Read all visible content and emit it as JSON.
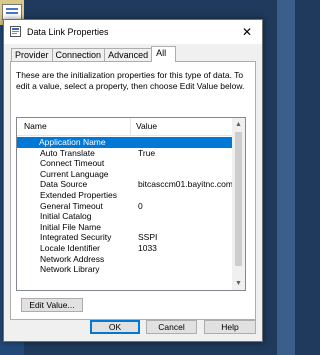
{
  "window": {
    "title": "Data Link Properties",
    "close_glyph": "✕"
  },
  "tabs": [
    {
      "label": "Provider"
    },
    {
      "label": "Connection"
    },
    {
      "label": "Advanced"
    },
    {
      "label": "All",
      "active": true
    }
  ],
  "intro_text": "These are the initialization properties for this type of data. To edit a value, select a property, then choose Edit Value below.",
  "list": {
    "columns": {
      "name": "Name",
      "value": "Value"
    },
    "rows": [
      {
        "name": "Application Name",
        "value": "",
        "selected": true
      },
      {
        "name": "Auto Translate",
        "value": "True"
      },
      {
        "name": "Connect Timeout",
        "value": ""
      },
      {
        "name": "Current Language",
        "value": ""
      },
      {
        "name": "Data Source",
        "value": "bitcasccm01.bayitnc.com"
      },
      {
        "name": "Extended Properties",
        "value": ""
      },
      {
        "name": "General Timeout",
        "value": "0"
      },
      {
        "name": "Initial Catalog",
        "value": ""
      },
      {
        "name": "Initial File Name",
        "value": ""
      },
      {
        "name": "Integrated Security",
        "value": "SSPI"
      },
      {
        "name": "Locale Identifier",
        "value": "1033"
      },
      {
        "name": "Network Address",
        "value": ""
      },
      {
        "name": "Network Library",
        "value": ""
      }
    ]
  },
  "buttons": {
    "edit": "Edit Value...",
    "ok": "OK",
    "cancel": "Cancel",
    "help": "Help"
  },
  "colors": {
    "selection": "#0078d7",
    "default_button_border": "#0078d7"
  }
}
